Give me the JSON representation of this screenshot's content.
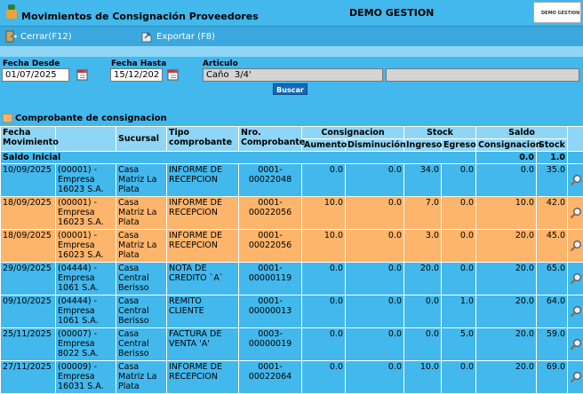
{
  "app": {
    "title": "Movimientos de Consignación Proveedores",
    "company": "DEMO GESTION",
    "logo_text": "DEMO GESTION"
  },
  "toolbar": {
    "close_label": "Cerrar(F12)",
    "export_label": "Exportar (F8)"
  },
  "filters": {
    "date_from_label": "Fecha Desde",
    "date_from_value": "01/07/2025",
    "date_to_label": "Fecha Hasta",
    "date_to_value": "15/12/2025",
    "article_label": "Articulo",
    "article_value": "Caño  3/4'",
    "article_desc_value": "",
    "search_label": "Buscar"
  },
  "legend": {
    "label": "Comprobante de consignacion",
    "color": "#fdb46b"
  },
  "table": {
    "headers": {
      "fecha": "Fecha Movimiento",
      "sucursal": "Sucursal",
      "tipo": "Tipo comprobante",
      "nro": "Nro. Comprobante",
      "group_consignacion": "Consignacion",
      "group_stock": "Stock",
      "group_saldo": "Saldo",
      "aumento": "Aumento",
      "disminucion": "Disminución",
      "ingreso": "Ingreso",
      "egreso": "Egreso",
      "saldo_consignacion": "Consignacion",
      "saldo_stock": "Stock"
    },
    "saldo_inicial": {
      "label": "Saldo Inicial",
      "consignacion": "0.0",
      "stock": "1.0"
    },
    "rows": [
      {
        "fecha": "10/09/2025",
        "proveedor": "(00001) - Empresa 16023 S.A.",
        "sucursal": "Casa Matriz La Plata",
        "tipo": "INFORME DE RECEPCION",
        "nro": "0001-00022048",
        "aumento": "0.0",
        "disminucion": "0.0",
        "ingreso": "34.0",
        "egreso": "0.0",
        "saldo_cons": "0.0",
        "saldo_stock": "35.0",
        "consignacion": false
      },
      {
        "fecha": "18/09/2025",
        "proveedor": "(00001) - Empresa 16023 S.A.",
        "sucursal": "Casa Matriz La Plata",
        "tipo": "INFORME DE RECEPCION",
        "nro": "0001-00022056",
        "aumento": "10.0",
        "disminucion": "0.0",
        "ingreso": "7.0",
        "egreso": "0.0",
        "saldo_cons": "10.0",
        "saldo_stock": "42.0",
        "consignacion": true
      },
      {
        "fecha": "18/09/2025",
        "proveedor": "(00001) - Empresa 16023 S.A.",
        "sucursal": "Casa Matriz La Plata",
        "tipo": "INFORME DE RECEPCION",
        "nro": "0001-00022056",
        "aumento": "10.0",
        "disminucion": "0.0",
        "ingreso": "3.0",
        "egreso": "0.0",
        "saldo_cons": "20.0",
        "saldo_stock": "45.0",
        "consignacion": true
      },
      {
        "fecha": "29/09/2025",
        "proveedor": "(04444) - Empresa 1061 S.A.",
        "sucursal": "Casa Central Berisso",
        "tipo": "NOTA DE CREDITO `A`",
        "nro": "0001-00000119",
        "aumento": "0.0",
        "disminucion": "0.0",
        "ingreso": "20.0",
        "egreso": "0.0",
        "saldo_cons": "20.0",
        "saldo_stock": "65.0",
        "consignacion": false
      },
      {
        "fecha": "09/10/2025",
        "proveedor": "(04444) - Empresa 1061 S.A.",
        "sucursal": "Casa Central Berisso",
        "tipo": "REMITO CLIENTE",
        "nro": "0001-00000013",
        "aumento": "0.0",
        "disminucion": "0.0",
        "ingreso": "0.0",
        "egreso": "1.0",
        "saldo_cons": "20.0",
        "saldo_stock": "64.0",
        "consignacion": false
      },
      {
        "fecha": "25/11/2025",
        "proveedor": "(00007) - Empresa 8022 S.A.",
        "sucursal": "Casa Central Berisso",
        "tipo": "FACTURA DE VENTA 'A'",
        "nro": "0003-00000019",
        "aumento": "0.0",
        "disminucion": "0.0",
        "ingreso": "0.0",
        "egreso": "5.0",
        "saldo_cons": "20.0",
        "saldo_stock": "59.0",
        "consignacion": false
      },
      {
        "fecha": "27/11/2025",
        "proveedor": "(00009) - Empresa 16031 S.A.",
        "sucursal": "Casa Matriz La Plata",
        "tipo": "INFORME DE RECEPCION",
        "nro": "0001-00022064",
        "aumento": "0.0",
        "disminucion": "0.0",
        "ingreso": "10.0",
        "egreso": "0.0",
        "saldo_cons": "20.0",
        "saldo_stock": "69.0",
        "consignacion": false
      }
    ]
  }
}
